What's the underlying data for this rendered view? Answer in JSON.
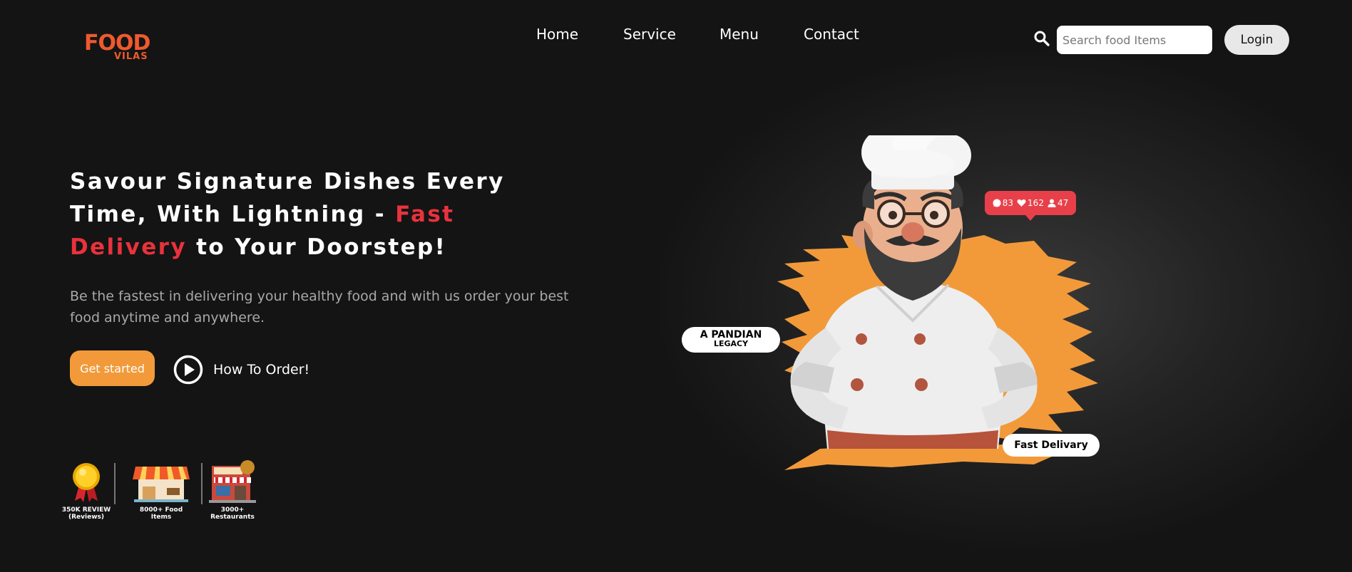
{
  "brand": {
    "logo_word1": "FOOD",
    "logo_word2": "VILAS",
    "color": "#ee5a2e"
  },
  "nav": {
    "items": [
      "Home",
      "Service",
      "Menu",
      "Contact"
    ]
  },
  "search": {
    "placeholder": "Search food Items",
    "value": "",
    "icon": "search-icon"
  },
  "login": {
    "label": "Login"
  },
  "hero": {
    "headline_part1": "Savour Signature Dishes Every Time, With Lightning - ",
    "headline_accent": "Fast Delivery",
    "headline_part2": " to Your Doorstep!",
    "accent_color": "#e8323c",
    "subtext": "Be the fastest in delivering your healthy food and with us order your best food anytime and anywhere.",
    "cta_label": "Get started",
    "cta_color": "#f29a3a",
    "how_to_label": "How To Order!",
    "how_to_icon": "play-circle-icon"
  },
  "stats": [
    {
      "icon": "award-medal-icon",
      "label": "350K REVIEW\n(Reviews)"
    },
    {
      "icon": "food-shop-icon",
      "label": "8000+ Food\nItems"
    },
    {
      "icon": "restaurant-building-icon",
      "label": "3000+\nRestaurants"
    }
  ],
  "illustration": {
    "comments": "83",
    "likes": "162",
    "followers": "47",
    "badge_color": "#e8404a",
    "splash_color": "#f29a3a",
    "tag_legacy_line1": "A PANDIAN",
    "tag_legacy_line2": "LEGACY",
    "tag_fast": "Fast Delivary"
  }
}
